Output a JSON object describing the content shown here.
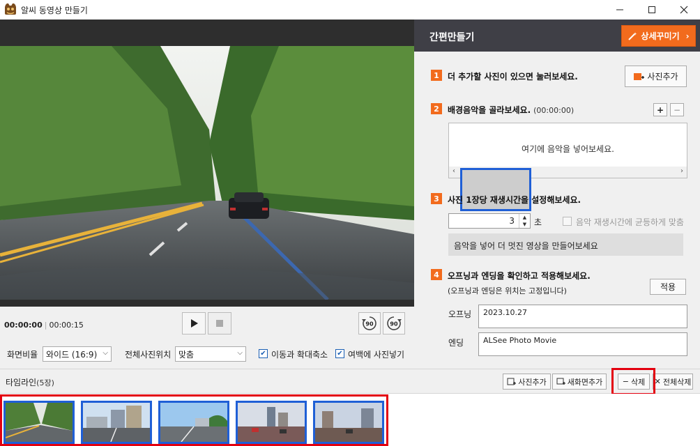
{
  "window": {
    "title": "알씨 동영상 만들기",
    "icon": "alsee-app-icon",
    "controls": [
      "minimize",
      "maximize",
      "close"
    ]
  },
  "player": {
    "current_time": "00:00:00",
    "total_time": "00:00:15",
    "rotate_left_label": "90",
    "rotate_right_label": "90"
  },
  "options": {
    "aspect_label": "화면비율",
    "aspect_value": "와이드 (16:9)",
    "position_label": "전체사진위치",
    "position_value": "맞춤",
    "move_zoom_label": "이동과 확대축소",
    "move_zoom_checked": true,
    "fill_blank_label": "여백에 사진넣기",
    "fill_blank_checked": true
  },
  "panel": {
    "title": "간편만들기",
    "advanced_button": "상세꾸미기",
    "steps": [
      {
        "num": "1",
        "text": "더 추가할 사진이 있으면 눌러보세요.",
        "extra": "",
        "button": "사진추가"
      },
      {
        "num": "2",
        "text": "배경음악을 골라보세요.",
        "extra": "(00:00:00)"
      },
      {
        "num": "3",
        "text": "사진 1장당 재생시간을 설정해보세요.",
        "extra": ""
      },
      {
        "num": "4",
        "text": "오프닝과 엔딩을 확인하고 적용해보세요.",
        "extra": ""
      }
    ],
    "music_empty": "여기에 음악을 넣어보세요.",
    "duration_value": "3",
    "duration_unit": "초",
    "sync_music_label": "음악 재생시간에 균등하게 맞춤",
    "music_tip": "음악을 넣어 더 멋진 영상을 만들어보세요",
    "step4_note": "(오프닝과 엔딩은 위치는 고정입니다)",
    "apply_button": "적용",
    "opening_label": "오프닝",
    "opening_value": "2023.10.27",
    "ending_label": "엔딩",
    "ending_value": "ALSee Photo Movie"
  },
  "timeline": {
    "title": "타임라인",
    "count": "(5장)",
    "add_photo": "사진추가",
    "add_scene": "새화면추가",
    "delete": "삭제",
    "delete_all": "전체삭제",
    "thumbnails": [
      {
        "scene": "rainy tree-lined road",
        "selected": true
      },
      {
        "scene": "city street with buildings",
        "selected": true
      },
      {
        "scene": "highway under blue sky",
        "selected": true
      },
      {
        "scene": "city road with cars",
        "selected": true
      },
      {
        "scene": "city street at sunset",
        "selected": true
      }
    ]
  }
}
